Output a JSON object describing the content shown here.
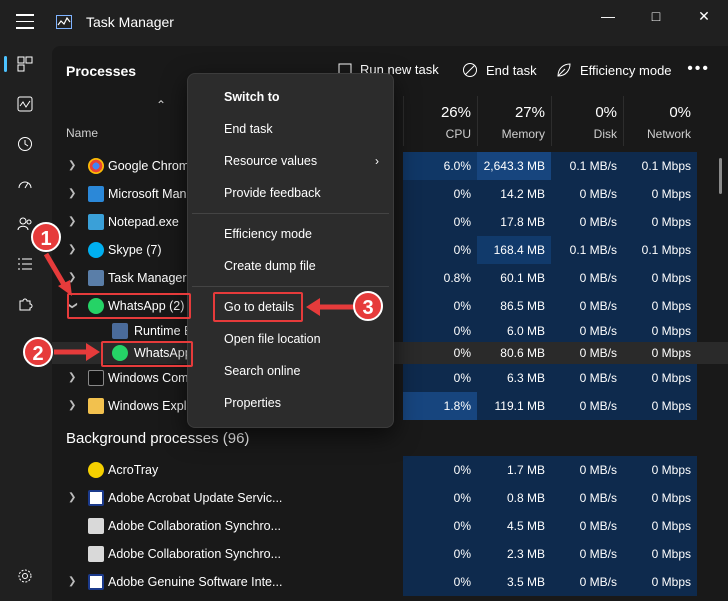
{
  "window": {
    "title": "Task Manager"
  },
  "toolbar": {
    "page_title": "Processes",
    "run_new_task": "Run new task",
    "end_task": "End task",
    "efficiency_mode": "Efficiency mode"
  },
  "header": {
    "name": "Name",
    "cpu": {
      "pct": "26%",
      "label": "CPU"
    },
    "memory": {
      "pct": "27%",
      "label": "Memory"
    },
    "disk": {
      "pct": "0%",
      "label": "Disk"
    },
    "network": {
      "pct": "0%",
      "label": "Network"
    }
  },
  "apps": [
    {
      "name": "Google Chrom",
      "cpu": "6.0%",
      "mem": "2,643.3 MB",
      "disk": "0.1 MB/s",
      "net": "0.1 Mbps"
    },
    {
      "name": "Microsoft Man",
      "cpu": "0%",
      "mem": "14.2 MB",
      "disk": "0 MB/s",
      "net": "0 Mbps"
    },
    {
      "name": "Notepad.exe",
      "cpu": "0%",
      "mem": "17.8 MB",
      "disk": "0 MB/s",
      "net": "0 Mbps"
    },
    {
      "name": "Skype (7)",
      "cpu": "0%",
      "mem": "168.4 MB",
      "disk": "0.1 MB/s",
      "net": "0.1 Mbps"
    },
    {
      "name": "Task Manager",
      "cpu": "0.8%",
      "mem": "60.1 MB",
      "disk": "0 MB/s",
      "net": "0 Mbps"
    },
    {
      "name": "WhatsApp (2)",
      "cpu": "0%",
      "mem": "86.5 MB",
      "disk": "0 MB/s",
      "net": "0 Mbps"
    },
    {
      "name": "Runtime B",
      "cpu": "0%",
      "mem": "6.0 MB",
      "disk": "0 MB/s",
      "net": "0 Mbps"
    },
    {
      "name": "WhatsApp",
      "cpu": "0%",
      "mem": "80.6 MB",
      "disk": "0 MB/s",
      "net": "0 Mbps"
    },
    {
      "name": "Windows Com",
      "cpu": "0%",
      "mem": "6.3 MB",
      "disk": "0 MB/s",
      "net": "0 Mbps"
    },
    {
      "name": "Windows Explo",
      "cpu": "1.8%",
      "mem": "119.1 MB",
      "disk": "0 MB/s",
      "net": "0 Mbps"
    }
  ],
  "background_title": "Background processes (96)",
  "background": [
    {
      "name": "AcroTray",
      "cpu": "0%",
      "mem": "1.7 MB",
      "disk": "0 MB/s",
      "net": "0 Mbps"
    },
    {
      "name": "Adobe Acrobat Update Servic...",
      "cpu": "0%",
      "mem": "0.8 MB",
      "disk": "0 MB/s",
      "net": "0 Mbps"
    },
    {
      "name": "Adobe Collaboration Synchro...",
      "cpu": "0%",
      "mem": "4.5 MB",
      "disk": "0 MB/s",
      "net": "0 Mbps"
    },
    {
      "name": "Adobe Collaboration Synchro...",
      "cpu": "0%",
      "mem": "2.3 MB",
      "disk": "0 MB/s",
      "net": "0 Mbps"
    },
    {
      "name": "Adobe Genuine Software Inte...",
      "cpu": "0%",
      "mem": "3.5 MB",
      "disk": "0 MB/s",
      "net": "0 Mbps"
    }
  ],
  "context_menu": {
    "switch_to": "Switch to",
    "end_task": "End task",
    "resource_values": "Resource values",
    "provide_feedback": "Provide feedback",
    "efficiency_mode": "Efficiency mode",
    "create_dump_file": "Create dump file",
    "go_to_details": "Go to details",
    "open_file_location": "Open file location",
    "search_online": "Search online",
    "properties": "Properties"
  },
  "callouts": {
    "one": "1",
    "two": "2",
    "three": "3"
  },
  "colors": {
    "accent": "#4cc2ff",
    "callout": "#e63b3b",
    "heat_dark": "#0e2a4d",
    "heat_light": "#113a6b"
  }
}
